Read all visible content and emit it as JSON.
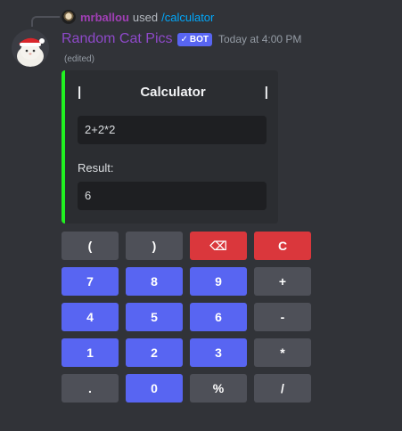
{
  "reply": {
    "username": "mrballou",
    "used_text": "used",
    "command": "/calculator"
  },
  "message": {
    "bot_name": "Random Cat Pics",
    "badge": "BOT",
    "timestamp": "Today at 4:00 PM",
    "edited": "(edited)"
  },
  "embed": {
    "accent_color": "#21f121",
    "title_left": "|",
    "title": "Calculator",
    "title_right": "|",
    "input_value": "2+2*2",
    "result_label": "Result:",
    "result_value": "6"
  },
  "buttons": [
    {
      "label": "(",
      "style": "grey"
    },
    {
      "label": ")",
      "style": "grey"
    },
    {
      "label": "⌫",
      "style": "red"
    },
    {
      "label": "C",
      "style": "red"
    },
    {
      "label": "7",
      "style": "blue"
    },
    {
      "label": "8",
      "style": "blue"
    },
    {
      "label": "9",
      "style": "blue"
    },
    {
      "label": "+",
      "style": "grey"
    },
    {
      "label": "4",
      "style": "blue"
    },
    {
      "label": "5",
      "style": "blue"
    },
    {
      "label": "6",
      "style": "blue"
    },
    {
      "label": "-",
      "style": "grey"
    },
    {
      "label": "1",
      "style": "blue"
    },
    {
      "label": "2",
      "style": "blue"
    },
    {
      "label": "3",
      "style": "blue"
    },
    {
      "label": "*",
      "style": "grey"
    },
    {
      "label": ".",
      "style": "grey"
    },
    {
      "label": "0",
      "style": "blue"
    },
    {
      "label": "%",
      "style": "grey"
    },
    {
      "label": "/",
      "style": "grey"
    }
  ]
}
